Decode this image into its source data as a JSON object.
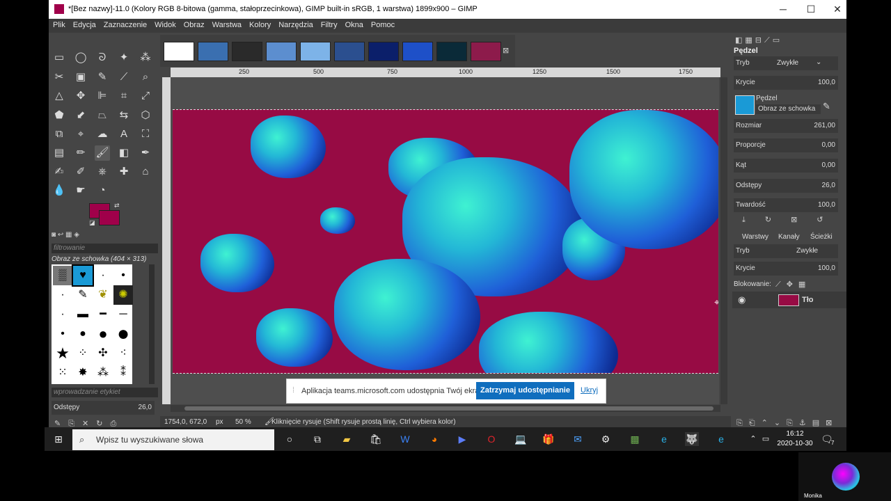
{
  "title": "*[Bez nazwy]-11.0 (Kolory RGB 8-bitowa (gamma, stałoprzecinkowa), GIMP built-in sRGB, 1 warstwa) 1899x900 – GIMP",
  "menu": [
    "Plik",
    "Edycja",
    "Zaznaczenie",
    "Widok",
    "Obraz",
    "Warstwa",
    "Kolory",
    "Narzędzia",
    "Filtry",
    "Okna",
    "Pomoc"
  ],
  "ruler_ticks": [
    "250",
    "500",
    "750",
    "1000",
    "1250",
    "1500",
    "1750"
  ],
  "brushes": {
    "filter_placeholder": "filtrowanie",
    "selected_brush": "Obraz ze schowka (404 × 313)",
    "tag_placeholder": "wprowadzanie etykiet",
    "spacing_label": "Odstępy",
    "spacing_value": "26,0"
  },
  "tool_options": {
    "title": "Pędzel",
    "mode_label": "Tryb",
    "mode_value": "Zwykłe",
    "opacity_label": "Krycie",
    "opacity_value": "100,0",
    "brush_label": "Pędzel",
    "brush_name": "Obraz ze schowka",
    "size_label": "Rozmiar",
    "size_value": "261,00",
    "aspect_label": "Proporcje",
    "aspect_value": "0,00",
    "angle_label": "Kąt",
    "angle_value": "0,00",
    "spacing_label": "Odstępy",
    "spacing_value": "26,0",
    "hardness_label": "Twardość",
    "hardness_value": "100,0"
  },
  "layers": {
    "tabs": [
      "Warstwy",
      "Kanały",
      "Ścieżki"
    ],
    "mode_label": "Tryb",
    "mode_value": "Zwykłe",
    "opacity_label": "Krycie",
    "opacity_value": "100,0",
    "lock_label": "Blokowanie:",
    "layer_name": "Tło"
  },
  "status": {
    "coords": "1754,0, 672,0",
    "unit": "px",
    "zoom": "50 %",
    "message": "Kliknięcie rysuje (Shift rysuje prostą linię, Ctrl wybiera kolor)"
  },
  "share_banner": {
    "text": "Aplikacja teams.microsoft.com udostępnia Twój ekran.",
    "stop": "Zatrzymaj udostępnianie",
    "hide": "Ukryj"
  },
  "taskbar": {
    "search_placeholder": "Wpisz tu wyszukiwane słowa",
    "time": "16:12",
    "date": "2020-10-30",
    "notif": "7"
  },
  "participant": "Monika",
  "colors": {
    "foreground": "#a0004a",
    "background": "#a0004a",
    "image_bg": "#970b44",
    "accent": "#106ebe"
  }
}
